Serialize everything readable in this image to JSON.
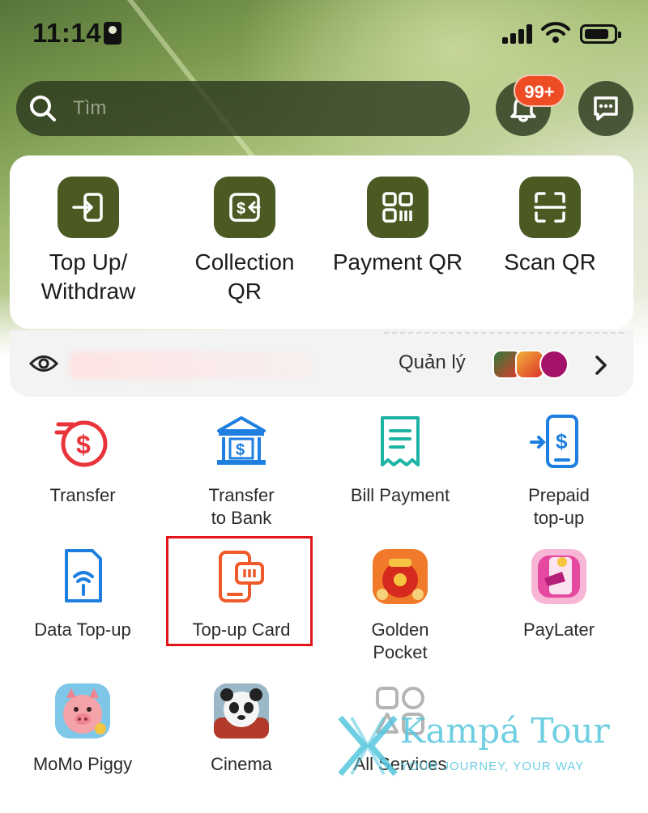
{
  "status_bar": {
    "time": "11:14"
  },
  "search": {
    "placeholder": "Tìm"
  },
  "notifications": {
    "badge": "99+"
  },
  "quick_actions": [
    {
      "label_line1": "Top Up/",
      "label_line2": "Withdraw",
      "icon": "top-up-withdraw-icon"
    },
    {
      "label_line1": "Collection",
      "label_line2": "QR",
      "icon": "collection-qr-icon"
    },
    {
      "label_line1": "Payment QR",
      "label_line2": "",
      "icon": "payment-qr-icon"
    },
    {
      "label_line1": "Scan QR",
      "label_line2": "",
      "icon": "scan-qr-icon"
    }
  ],
  "balance": {
    "manage_label": "Quản lý"
  },
  "services": [
    {
      "label_line1": "Transfer",
      "label_line2": "",
      "icon": "transfer-dollar-icon"
    },
    {
      "label_line1": "Transfer",
      "label_line2": "to Bank",
      "icon": "bank-icon"
    },
    {
      "label_line1": "Bill Payment",
      "label_line2": "",
      "icon": "bill-icon"
    },
    {
      "label_line1": "Prepaid",
      "label_line2": "top-up",
      "icon": "phone-topup-icon"
    },
    {
      "label_line1": "Data Top-up",
      "label_line2": "",
      "icon": "sim-data-icon"
    },
    {
      "label_line1": "Top-up Card",
      "label_line2": "",
      "icon": "topup-card-icon"
    },
    {
      "label_line1": "Golden",
      "label_line2": "Pocket",
      "icon": "golden-pocket-icon"
    },
    {
      "label_line1": "PayLater",
      "label_line2": "",
      "icon": "paylater-icon"
    },
    {
      "label_line1": "MoMo Piggy",
      "label_line2": "",
      "icon": "piggy-icon"
    },
    {
      "label_line1": "Cinema",
      "label_line2": "",
      "icon": "cinema-panda-icon"
    },
    {
      "label_line1": "All Services",
      "label_line2": "",
      "icon": "all-services-icon"
    }
  ],
  "watermark": {
    "title": "Kampá Tour",
    "tagline": "YOUR JOURNEY, YOUR WAY"
  },
  "colors": {
    "brand_dark": "#4a5a22",
    "accent_red": "#e8343a",
    "accent_blue": "#1f7fe0",
    "highlight": "#e0161b"
  }
}
